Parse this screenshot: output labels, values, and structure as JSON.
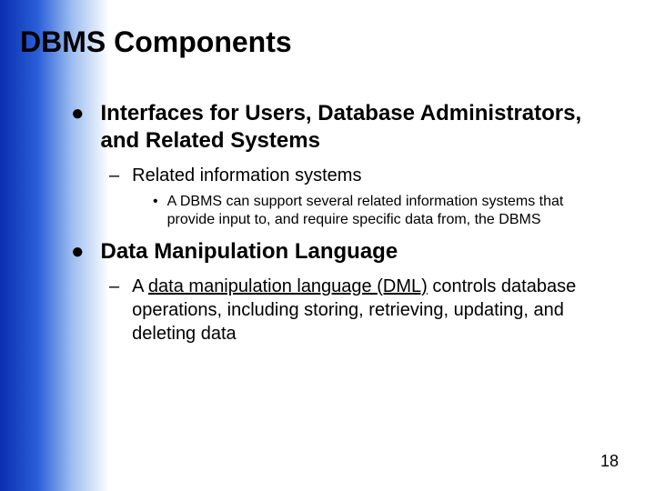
{
  "title": "DBMS Components",
  "bullets": {
    "b1": "Interfaces for Users, Database Administrators, and Related Systems",
    "b1_1": "Related information systems",
    "b1_1_1": "A DBMS can support several related information systems that provide input to, and require specific data from, the DBMS",
    "b2": "Data Manipulation Language",
    "b2_1_a": "A ",
    "b2_1_u": "data manipulation language (DML)",
    "b2_1_b": " controls database operations, including storing, retrieving, updating, and deleting data"
  },
  "page_number": "18"
}
